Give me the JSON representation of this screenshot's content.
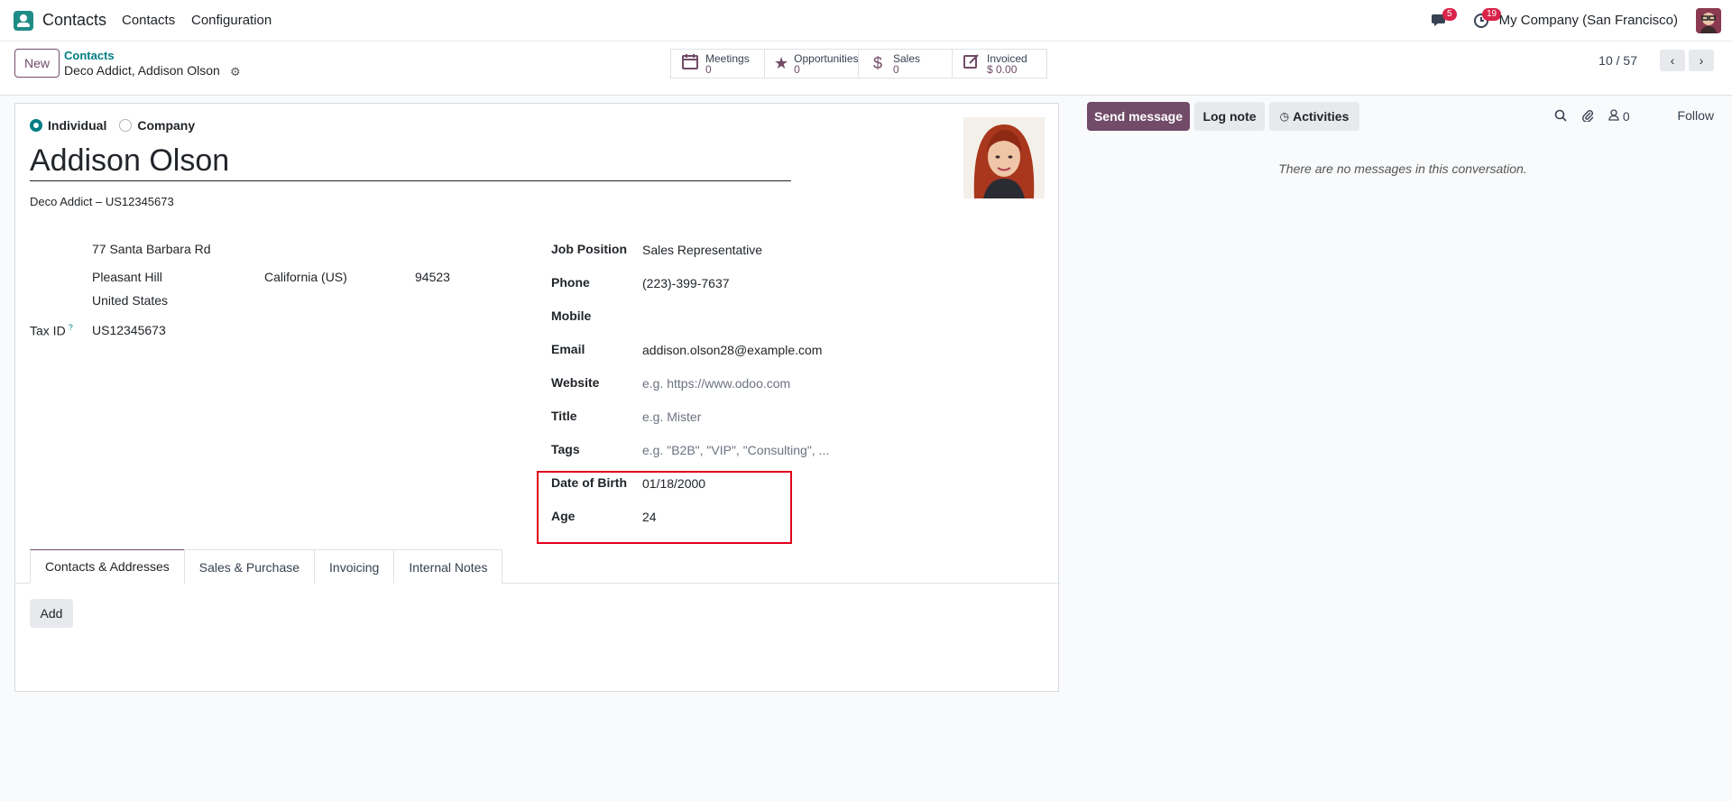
{
  "topbar": {
    "app_name": "Contacts",
    "menu": [
      "Contacts",
      "Configuration"
    ],
    "messages_count": "5",
    "activities_count": "19",
    "company": "My Company (San Francisco)"
  },
  "control": {
    "new_label": "New",
    "breadcrumb_parent": "Contacts",
    "breadcrumb_current": "Deco Addict, Addison Olson",
    "smart_buttons": [
      {
        "label": "Meetings",
        "value": "0",
        "icon": "calendar-icon"
      },
      {
        "label": "Opportunities",
        "value": "0",
        "icon": "star-icon"
      },
      {
        "label": "Sales",
        "value": "0",
        "icon": "dollar-icon"
      },
      {
        "label": "Invoiced",
        "value": "$ 0.00",
        "icon": "edit-icon"
      }
    ],
    "pager": "10 / 57"
  },
  "form": {
    "type_individual": "Individual",
    "type_company": "Company",
    "name": "Addison Olson",
    "company_line": "Deco Addict – US12345673",
    "address": {
      "street": "77 Santa Barbara Rd",
      "city": "Pleasant Hill",
      "state": "California (US)",
      "zip": "94523",
      "country": "United States"
    },
    "tax_id_label": "Tax ID",
    "tax_id_help": "?",
    "tax_id": "US12345673",
    "fields": {
      "job_position": {
        "label": "Job Position",
        "value": "Sales Representative"
      },
      "phone": {
        "label": "Phone",
        "value": "(223)-399-7637"
      },
      "mobile": {
        "label": "Mobile",
        "value": ""
      },
      "email": {
        "label": "Email",
        "value": "addison.olson28@example.com"
      },
      "website": {
        "label": "Website",
        "placeholder": "e.g. https://www.odoo.com"
      },
      "title": {
        "label": "Title",
        "placeholder": "e.g. Mister"
      },
      "tags": {
        "label": "Tags",
        "placeholder": "e.g. \"B2B\", \"VIP\", \"Consulting\", ..."
      },
      "dob": {
        "label": "Date of Birth",
        "value": "01/18/2000"
      },
      "age": {
        "label": "Age",
        "value": "24"
      }
    },
    "tabs": [
      "Contacts & Addresses",
      "Sales & Purchase",
      "Invoicing",
      "Internal Notes"
    ],
    "add_label": "Add"
  },
  "chatter": {
    "send_message": "Send message",
    "log_note": "Log note",
    "activities": "Activities",
    "followers_count": "0",
    "follow": "Follow",
    "empty": "There are no messages in this conversation."
  },
  "colors": {
    "brand": "#714b67",
    "accent": "#017e84",
    "highlight": "#e0001b"
  }
}
